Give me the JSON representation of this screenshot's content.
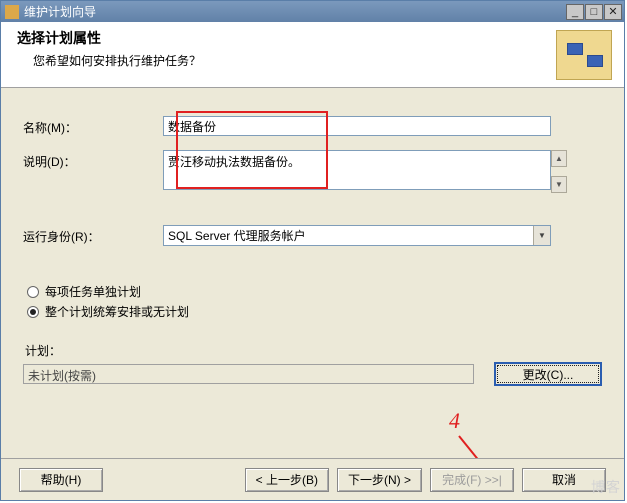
{
  "window": {
    "title": "维护计划向导"
  },
  "header": {
    "title": "选择计划属性",
    "subtitle": "您希望如何安排执行维护任务？"
  },
  "form": {
    "name_label": "名称(M)：",
    "name_value": "数据备份",
    "desc_label": "说明(D)：",
    "desc_value": "贾汪移动执法数据备份。",
    "runas_label": "运行身份(R)：",
    "runas_value": "SQL Server 代理服务帐户"
  },
  "radios": {
    "separate": "每项任务单独计划",
    "single": "整个计划统筹安排或无计划"
  },
  "plan": {
    "label": "计划：",
    "value": "未计划(按需)",
    "change_btn": "更改(C)..."
  },
  "buttons": {
    "help": "帮助(H)",
    "back": "< 上一步(B)",
    "next": "下一步(N) >",
    "finish": "完成(F) >>|",
    "cancel": "取消"
  },
  "annotation": {
    "marker": "4"
  },
  "watermark": "博客"
}
